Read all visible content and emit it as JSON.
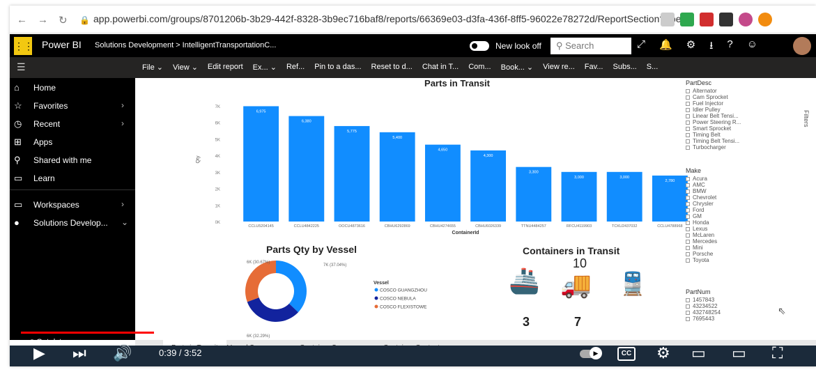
{
  "browser": {
    "url": "app.powerbi.com/groups/8701206b-3b29-442f-8328-3b9ec716baf8/reports/66369e03-d3fa-436f-8ff5-96022e78272d/ReportSection?ope..."
  },
  "powerbi_header": {
    "app_name": "Power BI",
    "breadcrumb": "Solutions Development > IntelligentTransportationC...",
    "new_look": "New look off",
    "search_placeholder": "Search"
  },
  "toolbar": {
    "items": [
      "File ⌄",
      "View ⌄",
      "Edit report",
      "Ex... ⌄",
      "Ref...",
      "Pin to a das...",
      "Reset to d...",
      "Chat in T...",
      "Com...",
      "Book... ⌄",
      "View re...",
      "Fav...",
      "Subs...",
      "S..."
    ]
  },
  "sidebar": {
    "items": [
      {
        "icon": "⌂",
        "label": "Home"
      },
      {
        "icon": "☆",
        "label": "Favorites",
        "chevron": "›"
      },
      {
        "icon": "◷",
        "label": "Recent",
        "chevron": "›"
      },
      {
        "icon": "⊞",
        "label": "Apps"
      },
      {
        "icon": "⚲",
        "label": "Shared with me"
      },
      {
        "icon": "▭",
        "label": "Learn"
      },
      {
        "icon": "▭",
        "label": "Workspaces",
        "chevron": "›"
      },
      {
        "icon": "●",
        "label": "Solutions Develop...",
        "chevron": "⌄"
      }
    ]
  },
  "chart_data": [
    {
      "type": "bar",
      "title": "Parts in Transit",
      "xlabel": "ContainerId",
      "ylabel": "Qty",
      "categories": [
        "CCLU5204145",
        "CCLU4842225",
        "OOCU4873616",
        "CBHU6292869",
        "CBHU4274655",
        "CBHU6026339",
        "TTNU4484257",
        "RFCU4119903",
        "TCKU2437032",
        "CCLU4788968"
      ],
      "values": [
        6975,
        6380,
        5775,
        5400,
        4650,
        4300,
        3300,
        3000,
        3000,
        2780
      ],
      "data_labels": [
        "6,975",
        "6,380",
        "5,775",
        "5,400",
        "4,650",
        "4,300",
        "3,300",
        "3,000",
        "3,000",
        "2,780"
      ],
      "yticks": [
        "0K",
        "1K",
        "2K",
        "3K",
        "4K",
        "5K",
        "6K",
        "7K"
      ],
      "ylim": [
        0,
        7500
      ],
      "color": "#118dff"
    },
    {
      "type": "pie",
      "title": "Parts Qty by Vessel",
      "legend_title": "Vessel",
      "series": [
        {
          "name": "COSCO GUANGZHOU",
          "value": 37.04,
          "label": "7K (37.04%)",
          "color": "#118dff"
        },
        {
          "name": "COSCO NEBULA",
          "value": 32.29,
          "label": "6K (32.29%)",
          "color": "#12239e"
        },
        {
          "name": "COSCO FLEXISTOWE",
          "value": 30.67,
          "label": "6K (30.67%)",
          "color": "#e66c37"
        }
      ]
    }
  ],
  "containers": {
    "title": "Containers in Transit",
    "total": "10",
    "ships": "3",
    "trucks": "7"
  },
  "filters": {
    "partdesc": {
      "header": "PartDesc",
      "items": [
        "Alternator",
        "Cam Sprocket",
        "Fuel Injector",
        "Idler Pulley",
        "Linear Belt Tensi...",
        "Power Steering R...",
        "Smart Sprocket",
        "Timing Belt",
        "Timing Belt Tensi...",
        "Turbocharger"
      ]
    },
    "make": {
      "header": "Make",
      "items": [
        "Acura",
        "AMC",
        "BMW",
        "Chevrolet",
        "Chrysler",
        "Ford",
        "GM",
        "Honda",
        "Lexus",
        "McLaren",
        "Mercedes",
        "Mini",
        "Porsche",
        "Toyota"
      ]
    },
    "partnum": {
      "header": "PartNum",
      "items": [
        "1457843",
        "43234522",
        "432748254",
        "7695443"
      ]
    },
    "side_label": "Filters"
  },
  "tabs": [
    "Parts in Transit",
    "Vessel Summary",
    "Container Summary",
    "Container Contents"
  ],
  "video": {
    "get_data": "Get data",
    "time": "0:39 / 3:52",
    "progress": 0.17,
    "cc": "CC"
  },
  "colors": {
    "accent": "#f2c811",
    "bar": "#118dff"
  }
}
